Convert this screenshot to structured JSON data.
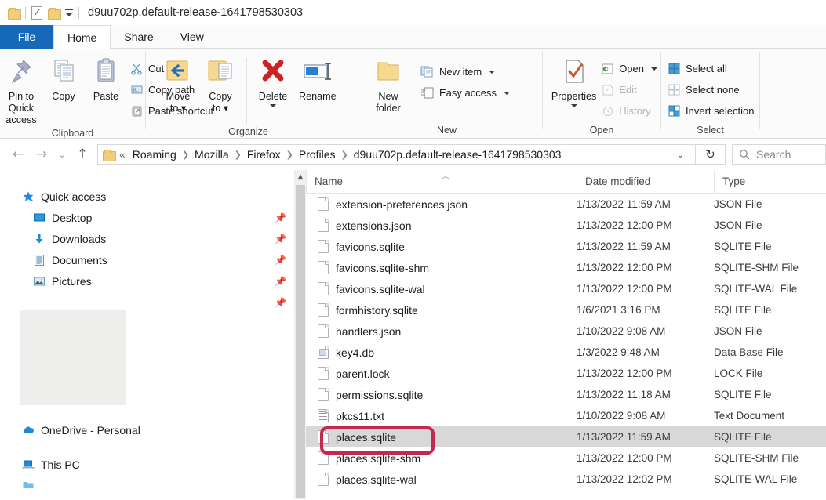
{
  "titlebar": {
    "window_title": "d9uu702p.default-release-1641798530303",
    "qat": [
      {
        "name": "folder-icon",
        "label": "Folder"
      },
      {
        "name": "properties-icon",
        "label": "Properties"
      },
      {
        "name": "new-folder-icon",
        "label": "New folder"
      },
      {
        "name": "customize-quick-access-toolbar-icon",
        "label": "Customize Quick Access Toolbar"
      }
    ]
  },
  "ribbon": {
    "tabs": [
      {
        "label": "File",
        "active": false,
        "style": "file"
      },
      {
        "label": "Home",
        "active": true,
        "style": "active"
      },
      {
        "label": "Share",
        "active": false,
        "style": "plain"
      },
      {
        "label": "View",
        "active": false,
        "style": "plain"
      }
    ],
    "groups": {
      "clipboard": {
        "label": "Clipboard",
        "pin_to_quick_access": "Pin to Quick\naccess",
        "pin_line1": "Pin to Quick",
        "pin_line2": "access",
        "copy": "Copy",
        "paste": "Paste",
        "cut": "Cut",
        "copy_path": "Copy path",
        "paste_shortcut": "Paste shortcut"
      },
      "organize": {
        "label": "Organize",
        "move_to_line1": "Move",
        "move_to_line2": "to",
        "copy_to_line1": "Copy",
        "copy_to_line2": "to",
        "delete": "Delete",
        "rename": "Rename"
      },
      "new": {
        "label": "New",
        "new_folder_line1": "New",
        "new_folder_line2": "folder",
        "new_item": "New item",
        "easy_access": "Easy access"
      },
      "open": {
        "label": "Open",
        "properties": "Properties",
        "open": "Open",
        "edit": "Edit",
        "history": "History"
      },
      "select": {
        "label": "Select",
        "select_all": "Select all",
        "select_none": "Select none",
        "invert_selection": "Invert selection"
      }
    }
  },
  "addressbar": {
    "back_icon": "←",
    "forward_icon": "→",
    "recent_icon": "⌄",
    "up_icon": "↑",
    "breadcrumb_overflow": "«",
    "crumbs": [
      "Roaming",
      "Mozilla",
      "Firefox",
      "Profiles",
      "d9uu702p.default-release-1641798530303"
    ],
    "dropdown_icon": "⌄",
    "refresh_icon": "↻",
    "search_placeholder": "Search",
    "search_value": ""
  },
  "sidebar": {
    "items": [
      {
        "label": "Quick access",
        "icon": "star-icon",
        "level": 1,
        "pinned": false
      },
      {
        "label": "Desktop",
        "icon": "desktop-icon",
        "level": 2,
        "pinned": true
      },
      {
        "label": "Downloads",
        "icon": "downloads-icon",
        "level": 2,
        "pinned": true
      },
      {
        "label": "Documents",
        "icon": "documents-icon",
        "level": 2,
        "pinned": true
      },
      {
        "label": "Pictures",
        "icon": "pictures-icon",
        "level": 2,
        "pinned": true
      },
      {
        "label": "",
        "icon": "redacted-icon",
        "level": 2,
        "pinned": true
      },
      {
        "label": "OneDrive - Personal",
        "icon": "onedrive-icon",
        "level": 1,
        "pinned": false
      },
      {
        "label": "This PC",
        "icon": "this-pc-icon",
        "level": 1,
        "pinned": false
      }
    ]
  },
  "filelist": {
    "columns": [
      "Name",
      "Date modified",
      "Type"
    ],
    "sort_column": "Name",
    "sort_direction": "ascending",
    "rows": [
      {
        "name": "extension-preferences.json",
        "date": "1/13/2022 11:59 AM",
        "type": "JSON File",
        "icon": "blank-file-icon",
        "selected": false
      },
      {
        "name": "extensions.json",
        "date": "1/13/2022 12:00 PM",
        "type": "JSON File",
        "icon": "blank-file-icon",
        "selected": false
      },
      {
        "name": "favicons.sqlite",
        "date": "1/13/2022 11:59 AM",
        "type": "SQLITE File",
        "icon": "blank-file-icon",
        "selected": false
      },
      {
        "name": "favicons.sqlite-shm",
        "date": "1/13/2022 12:00 PM",
        "type": "SQLITE-SHM File",
        "icon": "blank-file-icon",
        "selected": false
      },
      {
        "name": "favicons.sqlite-wal",
        "date": "1/13/2022 12:00 PM",
        "type": "SQLITE-WAL File",
        "icon": "blank-file-icon",
        "selected": false
      },
      {
        "name": "formhistory.sqlite",
        "date": "1/6/2021 3:16 PM",
        "type": "SQLITE File",
        "icon": "blank-file-icon",
        "selected": false
      },
      {
        "name": "handlers.json",
        "date": "1/10/2022 9:08 AM",
        "type": "JSON File",
        "icon": "blank-file-icon",
        "selected": false
      },
      {
        "name": "key4.db",
        "date": "1/3/2022 9:48 AM",
        "type": "Data Base File",
        "icon": "database-file-icon",
        "selected": false
      },
      {
        "name": "parent.lock",
        "date": "1/13/2022 12:00 PM",
        "type": "LOCK File",
        "icon": "blank-file-icon",
        "selected": false
      },
      {
        "name": "permissions.sqlite",
        "date": "1/13/2022 11:18 AM",
        "type": "SQLITE File",
        "icon": "blank-file-icon",
        "selected": false
      },
      {
        "name": "pkcs11.txt",
        "date": "1/10/2022 9:08 AM",
        "type": "Text Document",
        "icon": "text-file-icon",
        "selected": false
      },
      {
        "name": "places.sqlite",
        "date": "1/13/2022 11:59 AM",
        "type": "SQLITE File",
        "icon": "blank-file-icon",
        "selected": true
      },
      {
        "name": "places.sqlite-shm",
        "date": "1/13/2022 12:00 PM",
        "type": "SQLITE-SHM File",
        "icon": "blank-file-icon",
        "selected": false
      },
      {
        "name": "places.sqlite-wal",
        "date": "1/13/2022 12:02 PM",
        "type": "SQLITE-WAL File",
        "icon": "blank-file-icon",
        "selected": false
      }
    ]
  },
  "annotation": {
    "target": "places.sqlite",
    "color": "#c42a50",
    "shape": "rounded-rectangle"
  },
  "colors": {
    "file_tab_blue": "#1668b8",
    "selection_gray": "#d8d8d8",
    "annotation_red": "#c42a50",
    "folder_yellow": "#f3ce7a",
    "accent_blue": "#1e8bd8"
  }
}
